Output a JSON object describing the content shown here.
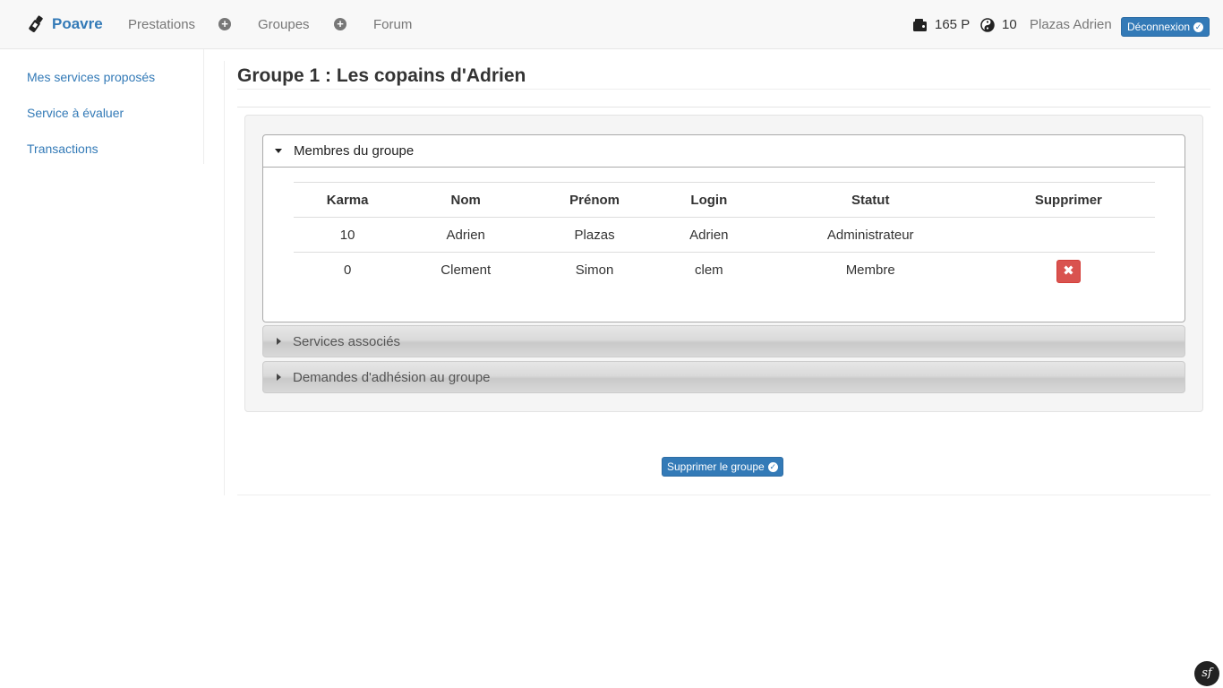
{
  "navbar": {
    "brand": "Poavre",
    "links": [
      "Prestations",
      "Groupes",
      "Forum"
    ],
    "points": "165 P",
    "karma": "10",
    "user": "Plazas Adrien",
    "logout": "Déconnexion"
  },
  "sidebar": {
    "items": [
      "Mes services proposés",
      "Service à évaluer",
      "Transactions"
    ]
  },
  "main": {
    "title": "Groupe 1 : Les copains d'Adrien",
    "panels": {
      "members_title": "Membres du groupe",
      "services_title": "Services associés",
      "requests_title": "Demandes d'adhésion au groupe"
    },
    "table": {
      "headers": [
        "Karma",
        "Nom",
        "Prénom",
        "Login",
        "Statut",
        "Supprimer"
      ],
      "rows": [
        [
          "10",
          "Adrien",
          "Plazas",
          "Adrien",
          "Administrateur"
        ],
        [
          "0",
          "Clement",
          "Simon",
          "clem",
          "Membre"
        ]
      ]
    },
    "delete_group": "Supprimer le groupe"
  },
  "colors": {
    "primary": "#337ab7",
    "danger": "#d9534f"
  }
}
